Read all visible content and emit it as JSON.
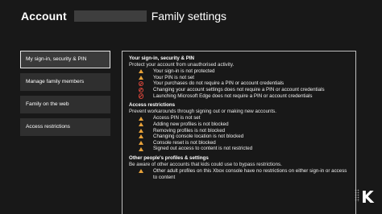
{
  "header": {
    "account": "Account",
    "title": "Family settings"
  },
  "sidebar": {
    "items": [
      {
        "label": "My sign-in, security & PIN"
      },
      {
        "label": "Manage family members"
      },
      {
        "label": "Family on the web"
      },
      {
        "label": "Access restrictions"
      }
    ]
  },
  "panel": {
    "sections": [
      {
        "title": "Your sign-in, security & PIN",
        "description": "Protect your account from unauthorised activity.",
        "rows": [
          {
            "icon": "warning-icon",
            "text": "Your sign-in is not protected"
          },
          {
            "icon": "warning-icon",
            "text": "Your PIN is not set"
          },
          {
            "icon": "no-entry-icon",
            "text": "Your purchases do not require a PIN or account credentials"
          },
          {
            "icon": "no-entry-icon",
            "text": "Changing your account settings does not require a PIN or account credentials"
          },
          {
            "icon": "no-entry-icon",
            "text": "Launching Microsoft Edge does not require a PIN or account credentials"
          }
        ]
      },
      {
        "title": "Access restrictions",
        "description": "Prevent workarounds through signing out or making new accounts.",
        "rows": [
          {
            "icon": "warning-icon",
            "text": "Access PIN is not set"
          },
          {
            "icon": "warning-icon",
            "text": "Adding new profiles is not blocked"
          },
          {
            "icon": "warning-icon",
            "text": "Removing profiles is not blocked"
          },
          {
            "icon": "warning-icon",
            "text": "Changing console location is not blocked"
          },
          {
            "icon": "warning-icon",
            "text": "Console reset is not blocked"
          },
          {
            "icon": "warning-icon",
            "text": "Signed out access to content is not restricted"
          }
        ]
      },
      {
        "title": "Other people's profiles & settings",
        "description": "Be aware of other accounts that kids could use to bypass restrictions.",
        "rows": [
          {
            "icon": "warning-icon",
            "text": "Other adult profiles on this Xbox console have no restrictions on either sign-in or access to content"
          }
        ]
      }
    ]
  },
  "colors": {
    "background": "#181818",
    "nav_item": "#2f2f2f",
    "warning": "#e8a23a",
    "blocked": "#d9453a"
  }
}
